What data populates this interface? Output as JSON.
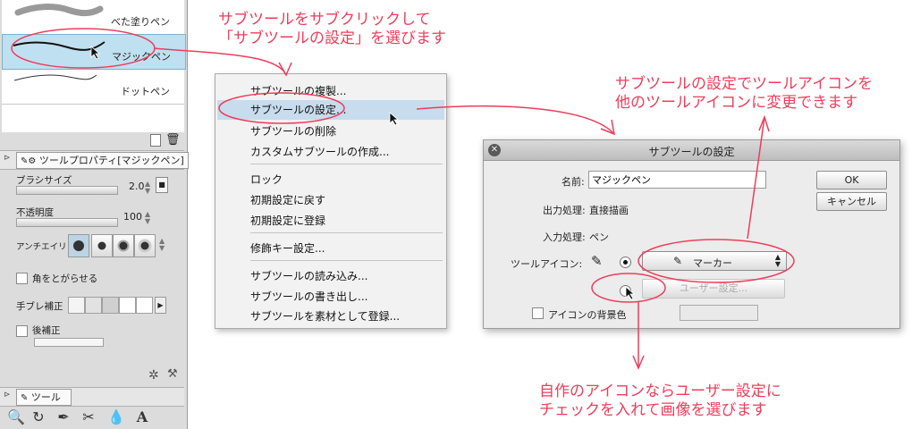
{
  "brush_list": {
    "items": [
      {
        "label": "べた塗りペン"
      },
      {
        "label": "マジックペン",
        "selected": true
      },
      {
        "label": "ドットペン"
      }
    ]
  },
  "tool_property": {
    "tab_title": "ツールプロパティ[マジックペン]",
    "brush_size_label": "ブラシサイズ",
    "brush_size_value": "2.0",
    "opacity_label": "不透明度",
    "opacity_value": "100",
    "antialias_label": "アンチエイリ",
    "sharp_corners_label": "角をとがらせる",
    "stabilization_label": "手ブレ補正",
    "post_correction_label": "後補正"
  },
  "tool_panel": {
    "tab_title": "ツール"
  },
  "context_menu": {
    "items": [
      "サブツールの複製...",
      "サブツールの設定...",
      "サブツールの削除",
      "カスタムサブツールの作成...",
      "ロック",
      "初期設定に戻す",
      "初期設定に登録",
      "修飾キー設定...",
      "サブツールの読み込み...",
      "サブツールの書き出し...",
      "サブツールを素材として登録..."
    ]
  },
  "dialog": {
    "title": "サブツールの設定",
    "name_label": "名前:",
    "name_value": "マジックペン",
    "output_label": "出力処理:",
    "output_value": "直接描画",
    "input_label": "入力処理:",
    "input_value": "ペン",
    "icon_label": "ツールアイコン:",
    "icon_select": "マーカー",
    "user_setting_button": "ユーザー設定...",
    "bg_color_label": "アイコンの背景色",
    "ok_button": "OK",
    "cancel_button": "キャンセル"
  },
  "annotations": {
    "top_line1": "サブツールをサブクリックして",
    "top_line2": "「サブツールの設定」を選びます",
    "right_line1": "サブツールの設定でツールアイコンを",
    "right_line2": "他のツールアイコンに変更できます",
    "bottom_line1": "自作のアイコンならユーザー設定に",
    "bottom_line2": "チェックを入れて画像を選びます"
  },
  "colors": {
    "annotation": "#ee3d5a",
    "highlight": "#c7dcec",
    "selected_brush": "#bfe0f0"
  }
}
